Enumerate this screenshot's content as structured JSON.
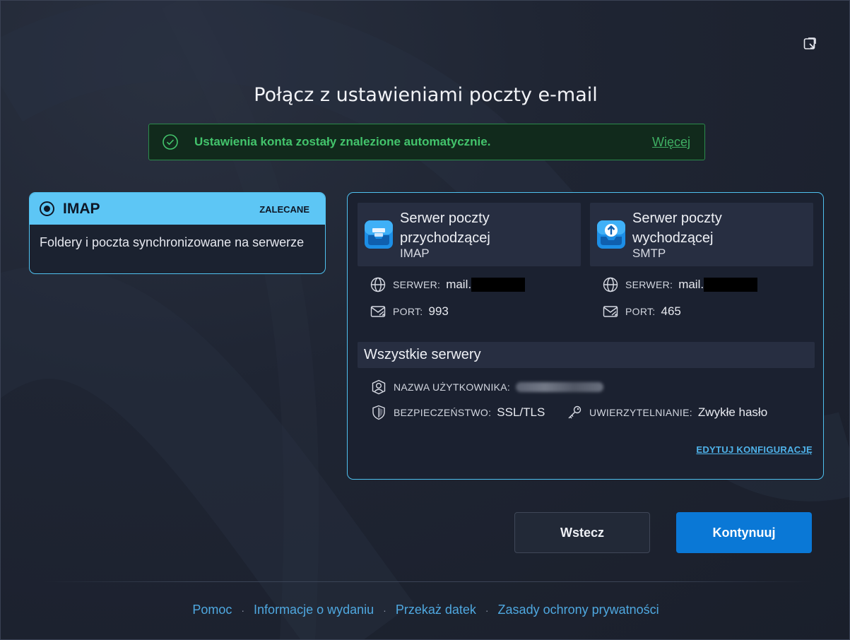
{
  "title": "Połącz z ustawieniami poczty e-mail",
  "notice": {
    "message": "Ustawienia konta zostały znalezione automatycznie.",
    "more_link": "Więcej"
  },
  "option": {
    "name": "IMAP",
    "badge": "ZALECANE",
    "description": "Foldery i poczta synchronizowane na serwerze"
  },
  "incoming": {
    "title": "Serwer poczty przychodzącej",
    "protocol": "IMAP",
    "server_label": "SERWER:",
    "server_value": "mail.",
    "port_label": "PORT:",
    "port_value": "993"
  },
  "outgoing": {
    "title": "Serwer poczty wychodzącej",
    "protocol": "SMTP",
    "server_label": "SERWER:",
    "server_value": "mail.",
    "port_label": "PORT:",
    "port_value": "465"
  },
  "all_servers": {
    "title": "Wszystkie serwery",
    "username_label": "NAZWA UŻYTKOWNIKA:",
    "security_label": "BEZPIECZEŃSTWO:",
    "security_value": "SSL/TLS",
    "auth_label": "UWIERZYTELNIANIE:",
    "auth_value": "Zwykłe hasło"
  },
  "edit_link": "EDYTUJ KONFIGURACJĘ",
  "buttons": {
    "back": "Wstecz",
    "continue": "Kontynuuj"
  },
  "footer": {
    "links": [
      "Pomoc",
      "Informacje o wydaniu",
      "Przekaż datek",
      "Zasady ochrony prywatności"
    ],
    "separator": "·"
  },
  "colors": {
    "accent": "#0a78d6",
    "option_header": "#5dc6f5",
    "success": "#43c46c",
    "link": "#4fa8e0"
  },
  "icons": {
    "restore": "restore-window-icon",
    "check": "check-circle-icon",
    "incoming": "inbox-tray-icon",
    "outgoing": "upload-tray-icon",
    "server": "globe-icon",
    "port": "envelope-port-icon",
    "username": "user-circle-icon",
    "security": "shield-icon",
    "auth": "key-icon"
  }
}
